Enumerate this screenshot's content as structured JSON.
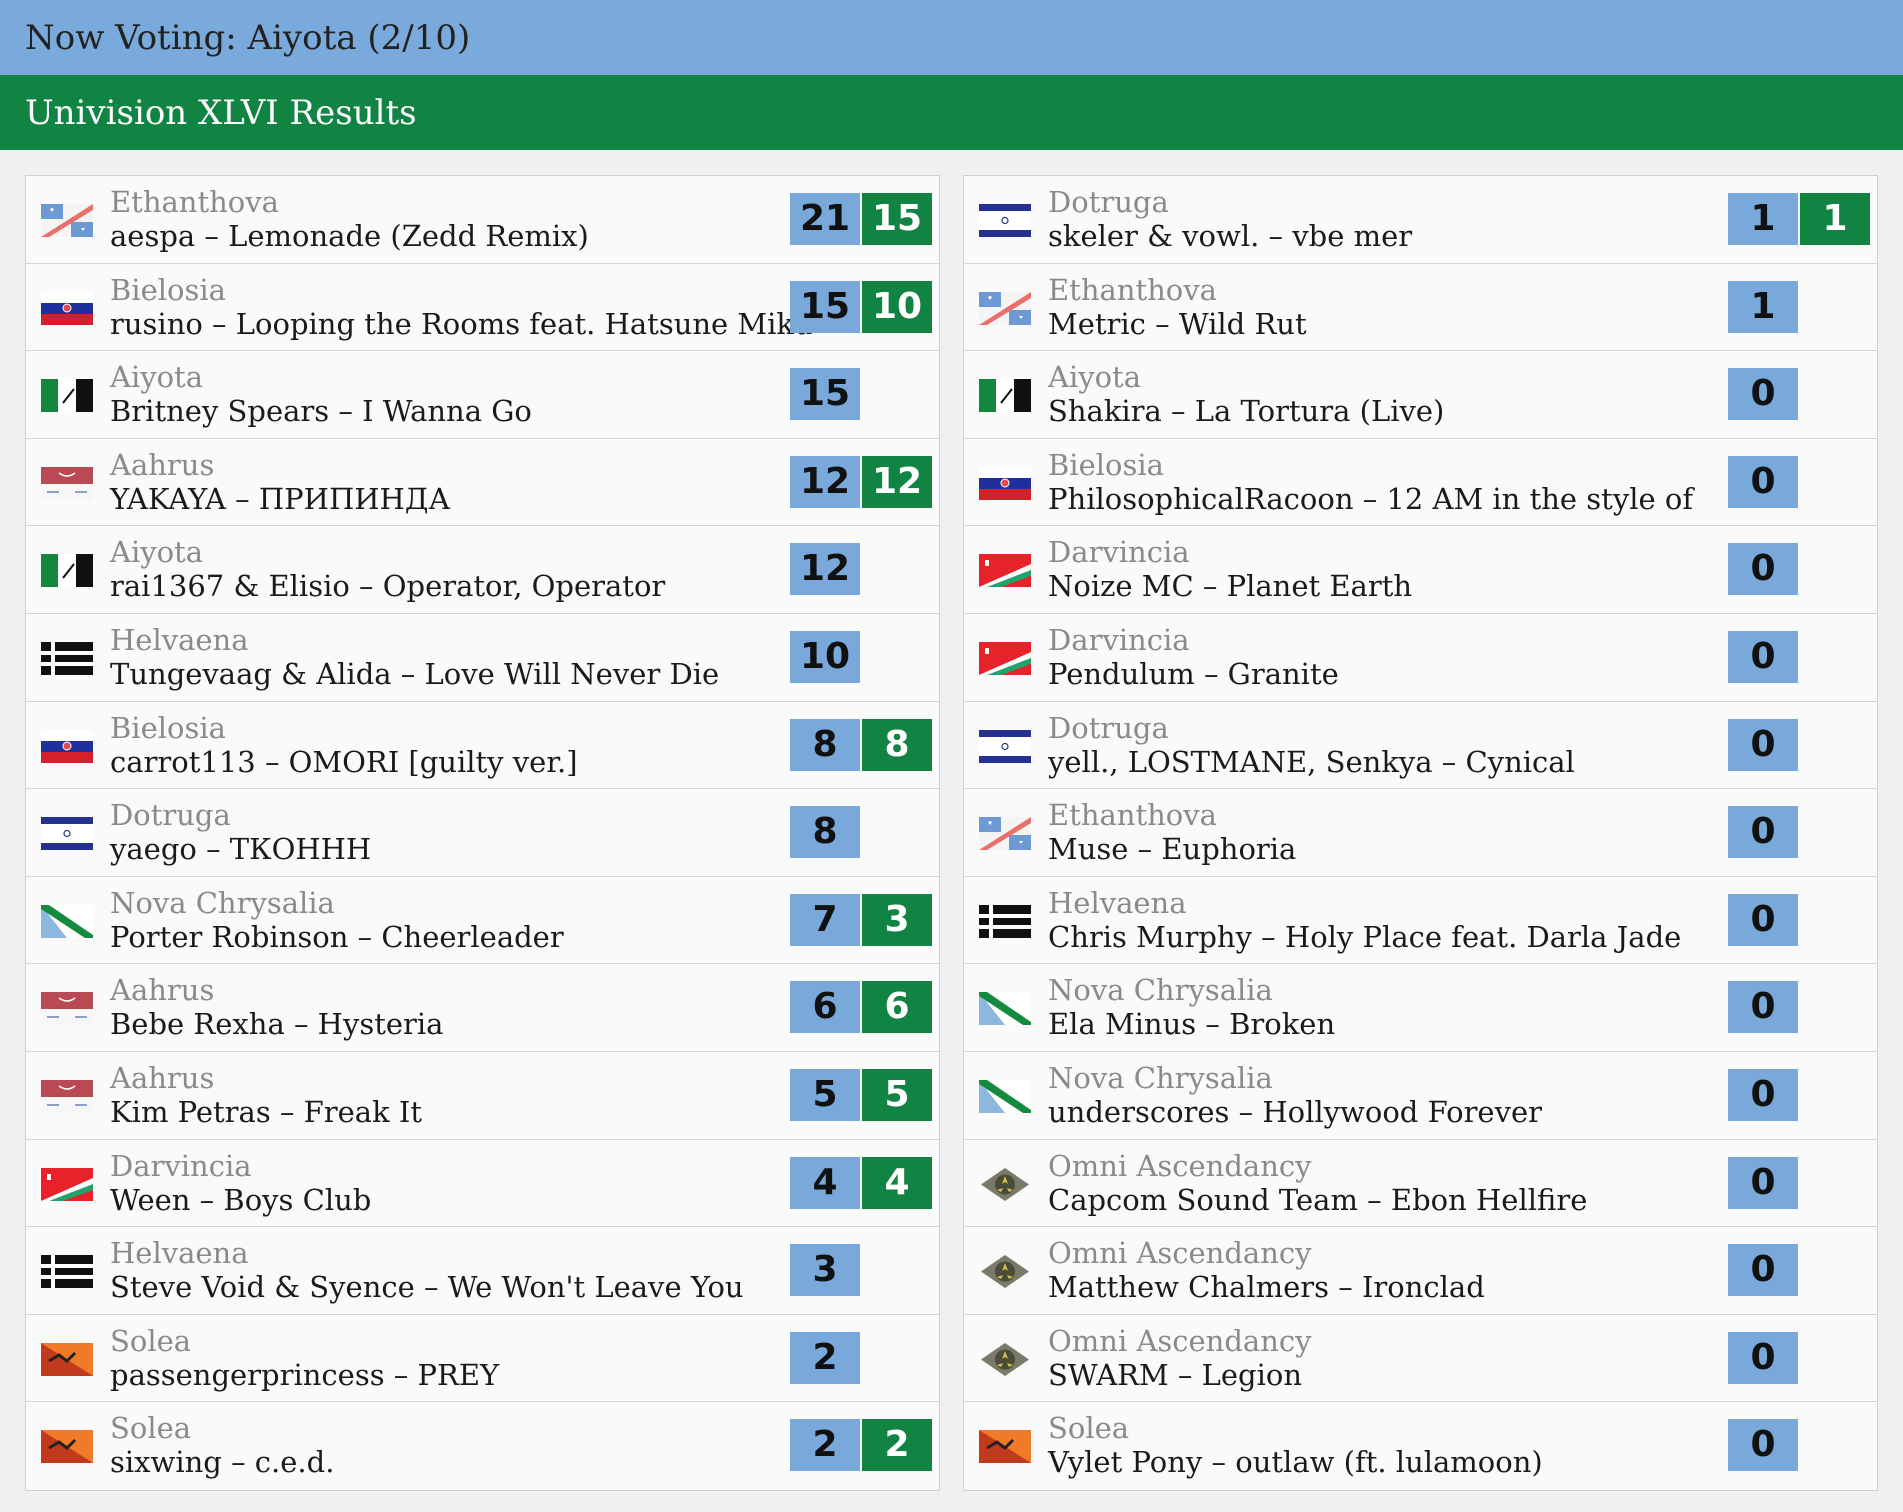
{
  "header": {
    "now_voting": "Now Voting: Aiyota (2/10)",
    "results_title": "Univision XLVI Results"
  },
  "colors": {
    "blue_header": "#79aadb",
    "green_header": "#118443",
    "score_blue": "#78a9da",
    "score_green": "#118443"
  },
  "left_entries": [
    {
      "country": "Ethanthova",
      "song": "aespa – Lemonade (Zedd Remix)",
      "score": "21",
      "points": "15",
      "flag": "ethanthova"
    },
    {
      "country": "Bielosia",
      "song": "rusino – Looping the Rooms feat. Hatsune Miku",
      "score": "15",
      "points": "10",
      "flag": "bielosia"
    },
    {
      "country": "Aiyota",
      "song": "Britney Spears – I Wanna Go",
      "score": "15",
      "points": "",
      "flag": "aiyota"
    },
    {
      "country": "Aahrus",
      "song": "YAKAYA – ПРИПИНДА",
      "score": "12",
      "points": "12",
      "flag": "aahrus"
    },
    {
      "country": "Aiyota",
      "song": "rai1367 & Elisio – Operator, Operator",
      "score": "12",
      "points": "",
      "flag": "aiyota"
    },
    {
      "country": "Helvaena",
      "song": "Tungevaag & Alida – Love Will Never Die",
      "score": "10",
      "points": "",
      "flag": "helvaena"
    },
    {
      "country": "Bielosia",
      "song": "carrot113 – OMORI [guilty ver.]",
      "score": "8",
      "points": "8",
      "flag": "bielosia"
    },
    {
      "country": "Dotruga",
      "song": "yaego – ТКОННН",
      "score": "8",
      "points": "",
      "flag": "dotruga"
    },
    {
      "country": "Nova Chrysalia",
      "song": "Porter Robinson – Cheerleader",
      "score": "7",
      "points": "3",
      "flag": "novachrysalia"
    },
    {
      "country": "Aahrus",
      "song": "Bebe Rexha – Hysteria",
      "score": "6",
      "points": "6",
      "flag": "aahrus"
    },
    {
      "country": "Aahrus",
      "song": "Kim Petras – Freak It",
      "score": "5",
      "points": "5",
      "flag": "aahrus"
    },
    {
      "country": "Darvincia",
      "song": "Ween – Boys Club",
      "score": "4",
      "points": "4",
      "flag": "darvincia"
    },
    {
      "country": "Helvaena",
      "song": "Steve Void & Syence – We Won't Leave You",
      "score": "3",
      "points": "",
      "flag": "helvaena"
    },
    {
      "country": "Solea",
      "song": "passengerprincess – PREY",
      "score": "2",
      "points": "",
      "flag": "solea"
    },
    {
      "country": "Solea",
      "song": "sixwing – c.e.d.",
      "score": "2",
      "points": "2",
      "flag": "solea"
    }
  ],
  "right_entries": [
    {
      "country": "Dotruga",
      "song": "skeler & vowl. – vbe mer",
      "score": "1",
      "points": "1",
      "flag": "dotruga"
    },
    {
      "country": "Ethanthova",
      "song": "Metric – Wild Rut",
      "score": "1",
      "points": "",
      "flag": "ethanthova"
    },
    {
      "country": "Aiyota",
      "song": "Shakira – La Tortura (Live)",
      "score": "0",
      "points": "",
      "flag": "aiyota"
    },
    {
      "country": "Bielosia",
      "song": "PhilosophicalRacoon – 12 AM in the style of",
      "score": "0",
      "points": "",
      "flag": "bielosia"
    },
    {
      "country": "Darvincia",
      "song": "Noize MC – Planet Earth",
      "score": "0",
      "points": "",
      "flag": "darvincia"
    },
    {
      "country": "Darvincia",
      "song": "Pendulum – Granite",
      "score": "0",
      "points": "",
      "flag": "darvincia"
    },
    {
      "country": "Dotruga",
      "song": "yell., LOSTMANE, Senkya – Cynical",
      "score": "0",
      "points": "",
      "flag": "dotruga"
    },
    {
      "country": "Ethanthova",
      "song": "Muse – Euphoria",
      "score": "0",
      "points": "",
      "flag": "ethanthova"
    },
    {
      "country": "Helvaena",
      "song": "Chris Murphy – Holy Place feat. Darla Jade",
      "score": "0",
      "points": "",
      "flag": "helvaena"
    },
    {
      "country": "Nova Chrysalia",
      "song": "Ela Minus – Broken",
      "score": "0",
      "points": "",
      "flag": "novachrysalia"
    },
    {
      "country": "Nova Chrysalia",
      "song": "underscores – Hollywood Forever",
      "score": "0",
      "points": "",
      "flag": "novachrysalia"
    },
    {
      "country": "Omni Ascendancy",
      "song": "Capcom Sound Team – Ebon Hellfire",
      "score": "0",
      "points": "",
      "flag": "omniascendancy"
    },
    {
      "country": "Omni Ascendancy",
      "song": "Matthew Chalmers – Ironclad",
      "score": "0",
      "points": "",
      "flag": "omniascendancy"
    },
    {
      "country": "Omni Ascendancy",
      "song": "SWARM – Legion",
      "score": "0",
      "points": "",
      "flag": "omniascendancy"
    },
    {
      "country": "Solea",
      "song": "Vylet Pony – outlaw (ft. lulamoon)",
      "score": "0",
      "points": "",
      "flag": "solea"
    }
  ]
}
